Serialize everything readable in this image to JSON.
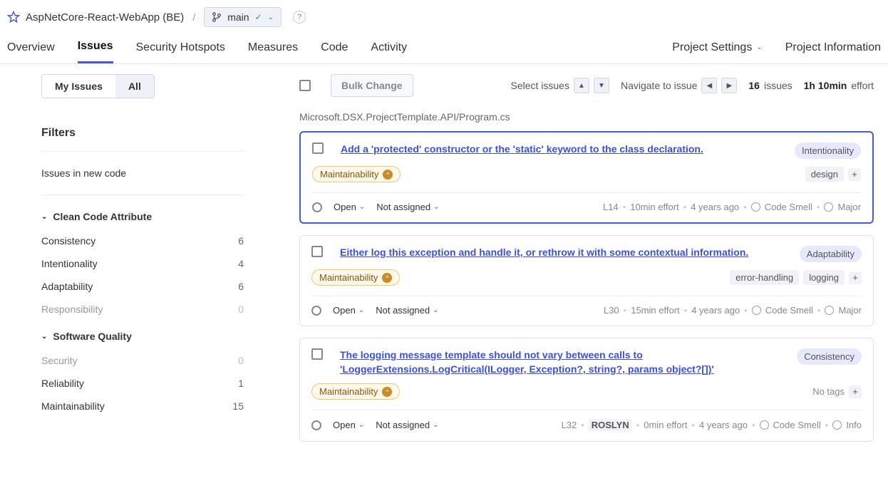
{
  "header": {
    "project_name": "AspNetCore-React-WebApp (BE)",
    "branch": "main",
    "help": "?"
  },
  "tabs": {
    "items": [
      "Overview",
      "Issues",
      "Security Hotspots",
      "Measures",
      "Code",
      "Activity"
    ],
    "settings": "Project Settings",
    "info": "Project Information"
  },
  "sidebar": {
    "my_issues": "My Issues",
    "all": "All",
    "filters_title": "Filters",
    "new_code": "Issues in new code",
    "clean_code": {
      "title": "Clean Code Attribute",
      "facets": [
        {
          "label": "Consistency",
          "count": "6",
          "muted": false
        },
        {
          "label": "Intentionality",
          "count": "4",
          "muted": false
        },
        {
          "label": "Adaptability",
          "count": "6",
          "muted": false
        },
        {
          "label": "Responsibility",
          "count": "0",
          "muted": true
        }
      ]
    },
    "software_quality": {
      "title": "Software Quality",
      "facets": [
        {
          "label": "Security",
          "count": "0",
          "muted": true
        },
        {
          "label": "Reliability",
          "count": "1",
          "muted": false
        },
        {
          "label": "Maintainability",
          "count": "15",
          "muted": false
        }
      ]
    }
  },
  "content": {
    "bulk_change": "Bulk Change",
    "select_label": "Select issues",
    "navigate_label": "Navigate to issue",
    "issues_count": "16",
    "issues_label": "issues",
    "effort": "1h 10min",
    "effort_label": "effort",
    "file_path": "Microsoft.DSX.ProjectTemplate.API/Program.cs",
    "issues": [
      {
        "title": "Add a 'protected' constructor or the 'static' keyword to the class declaration.",
        "attribute": "Intentionality",
        "quality": "Maintainability",
        "tags": [
          "design"
        ],
        "no_tags": false,
        "status": "Open",
        "assignee": "Not assigned",
        "line": "L14",
        "roslyn": false,
        "duration": "10min effort",
        "age": "4 years ago",
        "type": "Code Smell",
        "severity": "Major",
        "active": true
      },
      {
        "title": "Either log this exception and handle it, or rethrow it with some contextual information.",
        "attribute": "Adaptability",
        "quality": "Maintainability",
        "tags": [
          "error-handling",
          "logging"
        ],
        "no_tags": false,
        "status": "Open",
        "assignee": "Not assigned",
        "line": "L30",
        "roslyn": false,
        "duration": "15min effort",
        "age": "4 years ago",
        "type": "Code Smell",
        "severity": "Major",
        "active": false
      },
      {
        "title": "The logging message template should not vary between calls to 'LoggerExtensions.LogCritical(ILogger, Exception?, string?, params object?[])'",
        "attribute": "Consistency",
        "quality": "Maintainability",
        "tags": [],
        "no_tags": true,
        "status": "Open",
        "assignee": "Not assigned",
        "line": "L32",
        "roslyn": true,
        "duration": "0min effort",
        "age": "4 years ago",
        "type": "Code Smell",
        "severity": "Info",
        "active": false
      }
    ]
  }
}
